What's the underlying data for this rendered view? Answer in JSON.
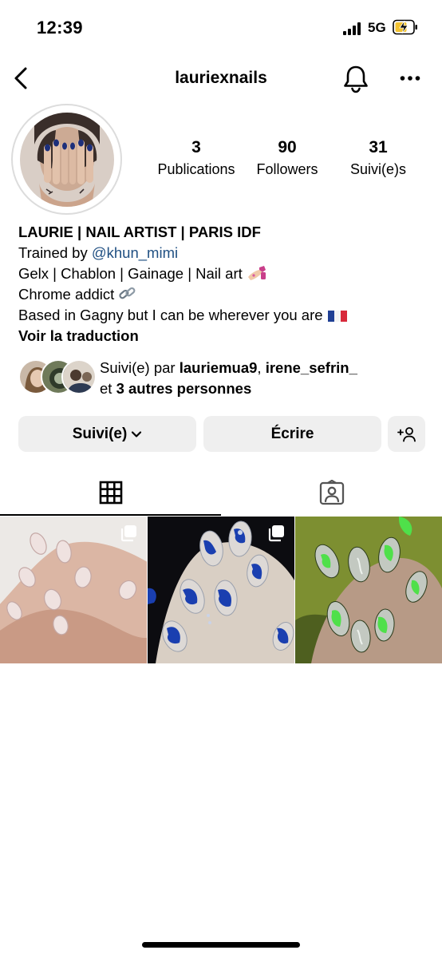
{
  "status_bar": {
    "time": "12:39",
    "network": "5G"
  },
  "header": {
    "username": "lauriexnails"
  },
  "stats": [
    {
      "value": "3",
      "label": "Publications"
    },
    {
      "value": "90",
      "label": "Followers"
    },
    {
      "value": "31",
      "label": "Suivi(e)s"
    }
  ],
  "bio": {
    "name": "LAURIE | NAIL ARTIST | PARIS IDF",
    "trained_prefix": "Trained by ",
    "trained_mention": "@khun_mimi",
    "line_services": "Gelx | Chablon | Gainage | Nail art",
    "line_chrome": "Chrome addict",
    "line_location": "Based in Gagny but I can be wherever you are",
    "translate": "Voir la traduction"
  },
  "followed_by": {
    "prefix": "Suivi(e) par ",
    "user1": "lauriemua9",
    "separator": ", ",
    "user2": "irene_sefrin_",
    "et": "et ",
    "others": "3 autres personnes"
  },
  "buttons": {
    "follow": "Suivi(e)",
    "message": "Écrire"
  },
  "icons": {
    "back": "chevron-left-icon",
    "bell": "bell-icon",
    "more": "more-horizontal-icon",
    "grid": "grid-icon",
    "tagged": "tagged-person-icon",
    "add_person": "add-person-icon",
    "chevron": "chevron-down-icon",
    "multi": "multiple-posts-icon"
  },
  "colors": {
    "mention": "#1f4f82",
    "button_bg": "#efefef"
  }
}
